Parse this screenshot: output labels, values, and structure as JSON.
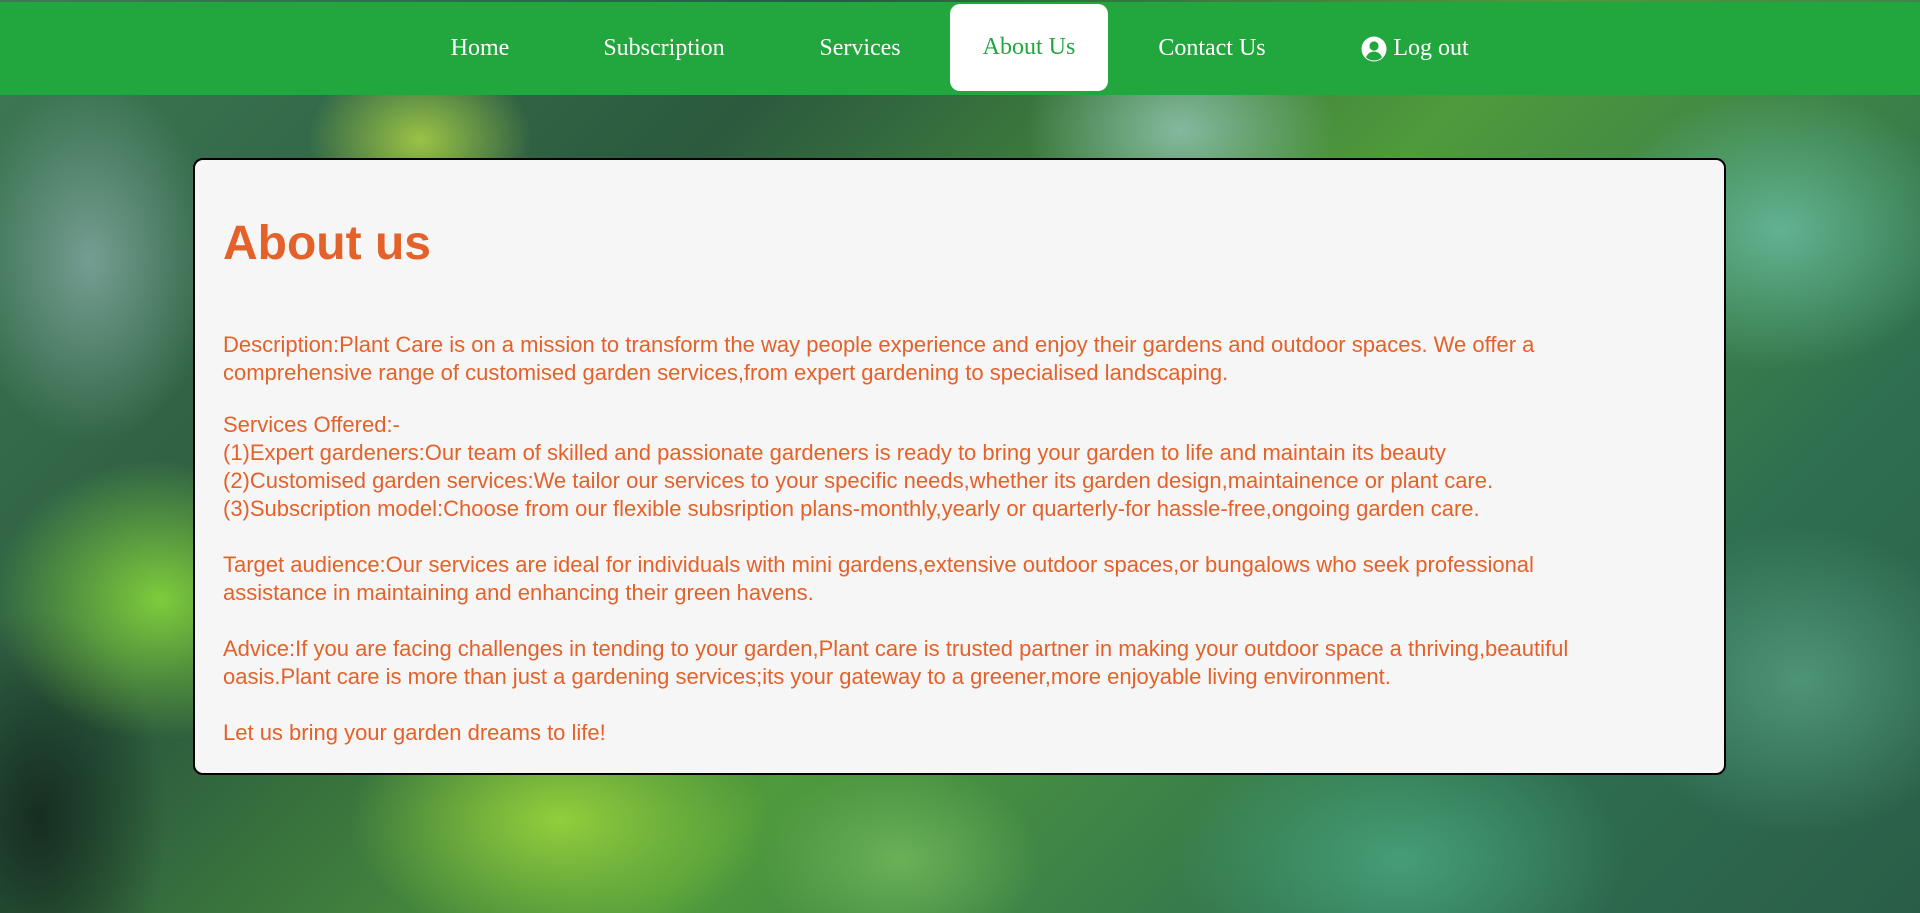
{
  "nav": {
    "items": [
      {
        "label": "Home"
      },
      {
        "label": "Subscription"
      },
      {
        "label": "Services"
      },
      {
        "label": "About Us"
      },
      {
        "label": "Contact Us"
      },
      {
        "label": "Log out",
        "icon": "user-circle-icon"
      }
    ],
    "active": "About Us",
    "background_color": "#22a73e",
    "active_text_color": "#22a73e"
  },
  "about": {
    "heading": "About us",
    "description_line1": "Description:Plant Care is on a mission to transform the way people experience and enjoy their gardens and outdoor spaces. We offer a",
    "description_line2": "comprehensive range of customised garden services,from expert gardening to specialised landscaping.",
    "services_heading": "Services Offered:-",
    "services": [
      "(1)Expert gardeners:Our team of skilled and passionate gardeners is ready to bring your garden to life and maintain its beauty",
      "(2)Customised garden services:We tailor our services to your specific needs,whether its garden design,maintainence or plant care.",
      "(3)Subscription model:Choose from our flexible subsription plans-monthly,yearly or quarterly-for hassle-free,ongoing garden care."
    ],
    "target_line1": "Target audience:Our services are ideal for individuals with mini gardens,extensive outdoor spaces,or bungalows who seek professional",
    "target_line2": "assistance in maintaining and enhancing their green havens.",
    "advice_line1": "Advice:If you are facing challenges in tending to your garden,Plant care is trusted partner in making your outdoor space a thriving,beautiful",
    "advice_line2": "oasis.Plant care is more than just a gardening services;its your gateway to a greener,more enjoyable living environment.",
    "closing": "Let us bring your garden dreams to life!",
    "text_color": "#e4612a"
  }
}
